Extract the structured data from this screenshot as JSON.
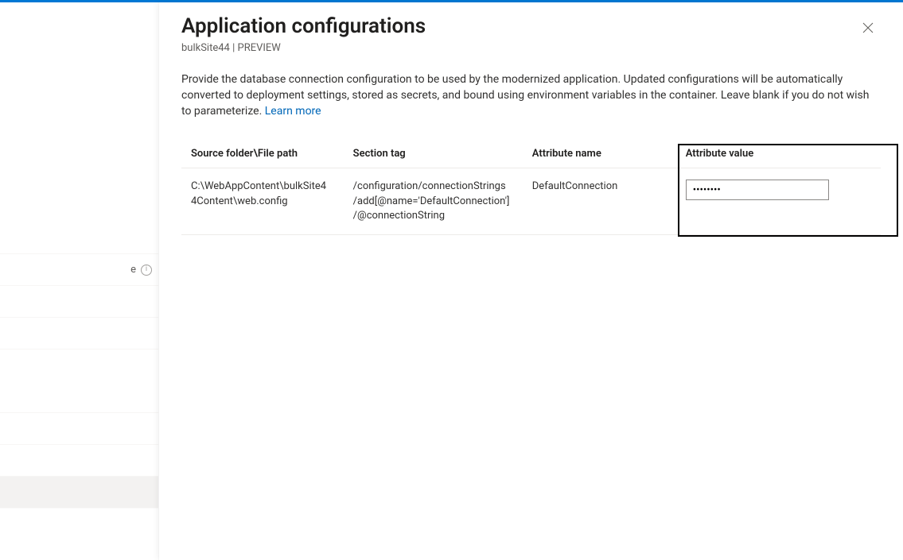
{
  "header": {
    "title": "Application configurations",
    "context": "bulkSite44",
    "badge": "PREVIEW"
  },
  "description": {
    "text": "Provide the database connection configuration to be used by the modernized application. Updated configurations will be automatically converted to deployment settings, stored as secrets, and bound using environment variables in the container. Leave blank if you do not wish to parameterize.",
    "learn_more": "Learn more"
  },
  "leftnav": {
    "frag_label": "e"
  },
  "table": {
    "columns": {
      "source": "Source folder\\File path",
      "section": "Section tag",
      "attrname": "Attribute name",
      "attrval": "Attribute value"
    },
    "rows": [
      {
        "source": "C:\\WebAppContent\\bulkSite44Content\\web.config",
        "section": "/configuration/connectionStrings/add[@name='DefaultConnection']/@connectionString",
        "attrname": "DefaultConnection",
        "attrval_masked": "••••••••"
      }
    ]
  },
  "colors": {
    "accent": "#0078d4",
    "link": "#0067b8",
    "highlight_border": "#000000"
  }
}
